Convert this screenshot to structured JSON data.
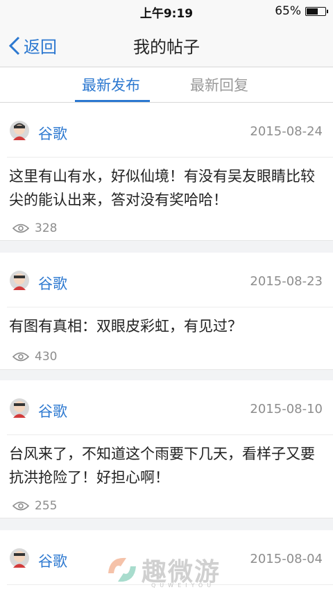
{
  "status_bar": {
    "time": "上午9:19",
    "battery": "65%",
    "battery_level": 0.65
  },
  "navbar": {
    "back_label": "返回",
    "title": "我的帖子"
  },
  "tabs": [
    {
      "label": "最新发布",
      "active": true
    },
    {
      "label": "最新回复",
      "active": false
    }
  ],
  "posts": [
    {
      "author": "谷歌",
      "date": "2015-08-24",
      "text": "这里有山有水，好似仙境！有没有吴友眼睛比较尖的能认出来，答对没有奖哈哈！",
      "views": "328"
    },
    {
      "author": "谷歌",
      "date": "2015-08-23",
      "text": "有图有真相：双眼皮彩虹，有见过？",
      "views": "430"
    },
    {
      "author": "谷歌",
      "date": "2015-08-10",
      "text": "台风来了，不知道这个雨要下几天，看样子又要抗洪抢险了！好担心啊！",
      "views": "255"
    },
    {
      "author": "谷歌",
      "date": "2015-08-04",
      "text": "",
      "views": ""
    }
  ],
  "watermark": {
    "text": "趣微游",
    "sub": "QUWEIYOU"
  },
  "colors": {
    "accent": "#2c78d0",
    "muted": "#8d8d8d",
    "background": "#f2f3f5"
  }
}
